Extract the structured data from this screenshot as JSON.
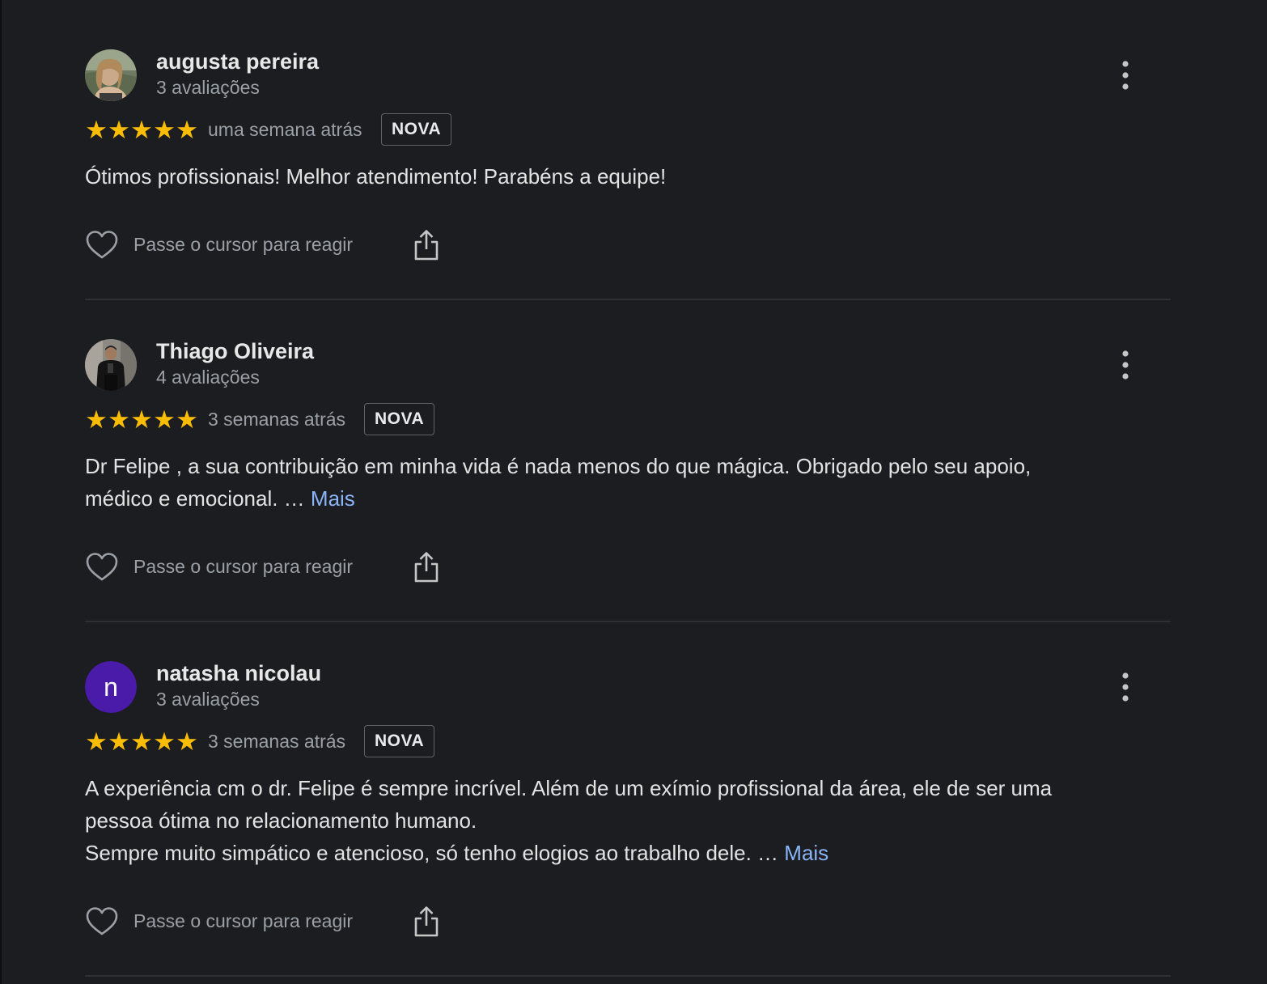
{
  "reviews": [
    {
      "name": "augusta pereira",
      "count": "3 avaliações",
      "stars": "★★★★★",
      "when": "uma semana atrás",
      "badge": "NOVA",
      "text": "Ótimos profissionais! Melhor atendimento! Parabéns a equipe!",
      "react_label": "Passe o cursor para reagir",
      "avatar": "photo"
    },
    {
      "name": "Thiago Oliveira",
      "count": "4 avaliações",
      "stars": "★★★★★",
      "when": "3 semanas atrás",
      "badge": "NOVA",
      "text_lines": [
        "Dr Felipe , a sua contribuição em minha vida é nada menos do que mágica. Obrigado pelo seu apoio,",
        "médico e emocional. … "
      ],
      "more": "Mais",
      "react_label": "Passe o cursor para reagir",
      "avatar": "photo"
    },
    {
      "name": "natasha nicolau",
      "count": "3 avaliações",
      "stars": "★★★★★",
      "when": "3 semanas atrás",
      "badge": "NOVA",
      "text_lines": [
        "A experiência cm o dr. Felipe é sempre incrível. Além de um exímio profissional da área, ele de ser uma",
        "pessoa ótima no relacionamento humano.",
        "Sempre muito simpático e atencioso, só tenho elogios ao trabalho dele. … "
      ],
      "more": "Mais",
      "react_label": "Passe o cursor para reagir",
      "avatar_letter": "n",
      "avatar_color": "#4a1aa8"
    }
  ],
  "colors": {
    "background": "#1c1d20",
    "star": "#fbbc04",
    "link": "#8ab4f8",
    "secondary_text": "#9aa0a6"
  },
  "icons": [
    "kebab-menu-icon",
    "heart-icon",
    "share-icon",
    "star-icon"
  ]
}
